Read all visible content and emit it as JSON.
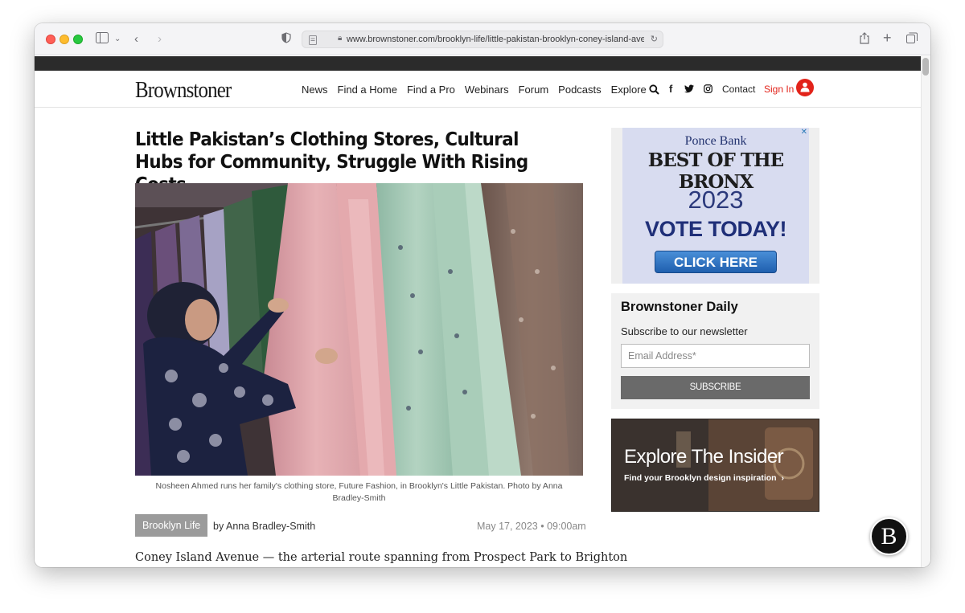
{
  "browser": {
    "url": "www.brownstoner.com/brooklyn-life/little-pakistan-brooklyn-coney-island-ave"
  },
  "site": {
    "logo": "Brownstoner",
    "nav": [
      "News",
      "Find a Home",
      "Find a Pro",
      "Webinars",
      "Forum",
      "Podcasts",
      "Explore"
    ],
    "contact": "Contact",
    "signin": "Sign In"
  },
  "article": {
    "headline": "Little Pakistan’s Clothing Stores, Cultural Hubs for Community, Struggle With Rising Costs",
    "caption": "Nosheen Ahmed runs her family's clothing store, Future Fashion, in Brooklyn's Little Pakistan. Photo by Anna Bradley-Smith",
    "tag": "Brooklyn Life",
    "byline": "by Anna Bradley-Smith",
    "date": "May 17, 2023 • 09:00am",
    "body_start": "Coney Island Avenue — the arterial route spanning from Prospect Park to Brighton"
  },
  "ad_bronx": {
    "bank": "Ponce Bank",
    "best": "BEST OF THE BRONX",
    "year": "2023",
    "vote": "VOTE TODAY!",
    "click": "CLICK HERE"
  },
  "newsletter": {
    "title": "Brownstoner Daily",
    "subtitle": "Subscribe to our newsletter",
    "placeholder": "Email Address*",
    "button": "SUBSCRIBE"
  },
  "ad_insider": {
    "title": "Explore The Insider",
    "subtitle": "Find your Brooklyn design inspiration"
  },
  "fab_letter": "B",
  "colors": {
    "accent_red": "#e2231a",
    "tag_gray": "#9b9b9b",
    "button_gray": "#6a6a6a"
  }
}
